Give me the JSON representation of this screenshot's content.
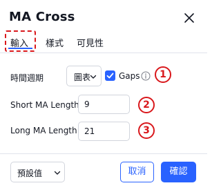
{
  "dialog": {
    "title": "MA Cross",
    "close_icon": "close-icon"
  },
  "tabs": [
    {
      "label": "輸入",
      "active": true
    },
    {
      "label": "樣式",
      "active": false
    },
    {
      "label": "可見性",
      "active": false
    }
  ],
  "inputs": {
    "timeframe": {
      "label": "時間週期",
      "value": "圖表"
    },
    "gaps": {
      "label": "Gaps",
      "checked": true,
      "info_icon": "info-icon"
    },
    "short_ma": {
      "label": "Short MA Length",
      "value": "9"
    },
    "long_ma": {
      "label": "Long MA Length",
      "value": "21"
    }
  },
  "callouts": [
    "1",
    "2",
    "3"
  ],
  "footer": {
    "defaults_label": "預設值",
    "cancel_label": "取消",
    "ok_label": "確認"
  },
  "colors": {
    "accent": "#2962ff",
    "annotation": "#d9171b",
    "border": "#d1d4dc",
    "text": "#131722"
  }
}
